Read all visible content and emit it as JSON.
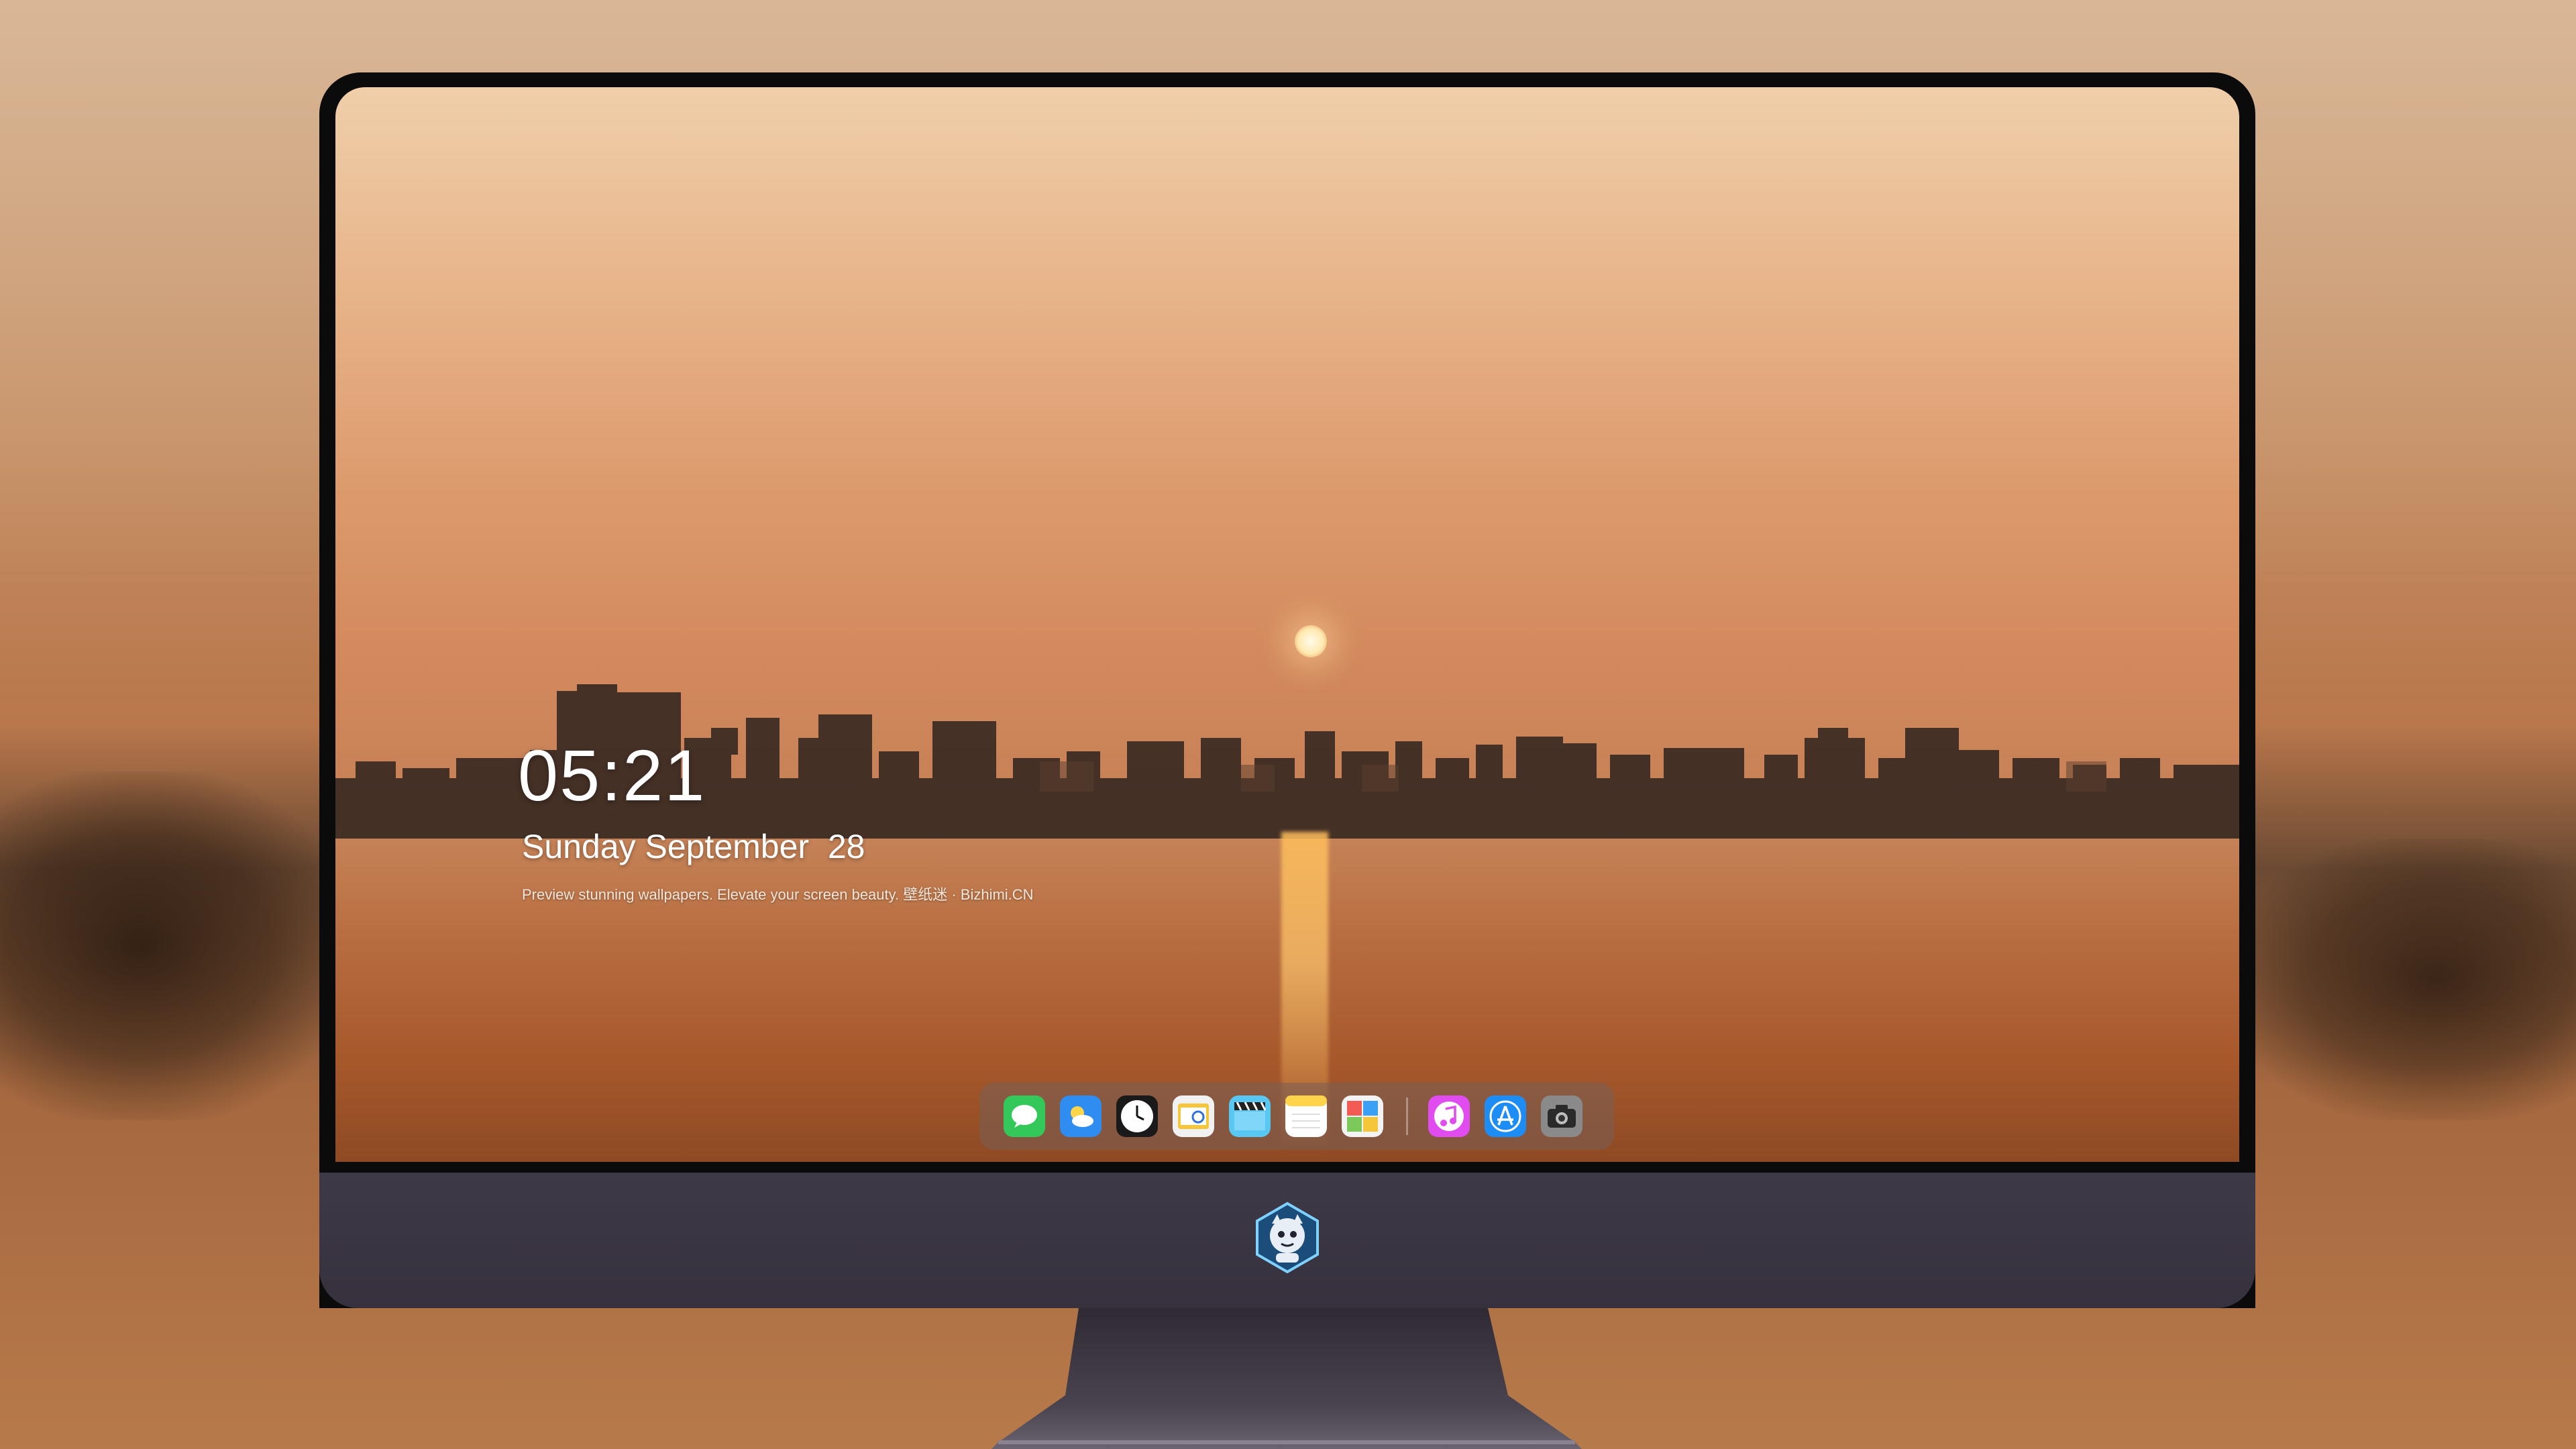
{
  "lockscreen": {
    "time": "05:21",
    "date": "Sunday September  28",
    "tagline": "Preview stunning wallpapers. Elevate your screen beauty. 壁纸迷 · Bizhimi.CN"
  },
  "dock": {
    "apps": [
      {
        "name": "messages-icon",
        "color": "#3ad05a"
      },
      {
        "name": "weather-icon",
        "color": "#2f8cf0"
      },
      {
        "name": "clock-icon",
        "color": "#1a1a1a"
      },
      {
        "name": "preview-icon",
        "color": "#f5c53a"
      },
      {
        "name": "video-editor-icon",
        "color": "#58c7f2"
      },
      {
        "name": "notes-icon",
        "color": "#ffd34a"
      },
      {
        "name": "photos-app-icon",
        "color": "#7bc95a"
      },
      {
        "name": "music-icon",
        "color": "#e04cf0"
      },
      {
        "name": "app-store-icon",
        "color": "#1e8cf5"
      },
      {
        "name": "camera-icon",
        "color": "#8a8a8a"
      }
    ]
  },
  "colors": {
    "sky_top": "#efcfaa",
    "sky_mid": "#d38a5e",
    "water": "#a6582b",
    "bezel": "#0c0b0c",
    "chin": "#3e3947"
  }
}
